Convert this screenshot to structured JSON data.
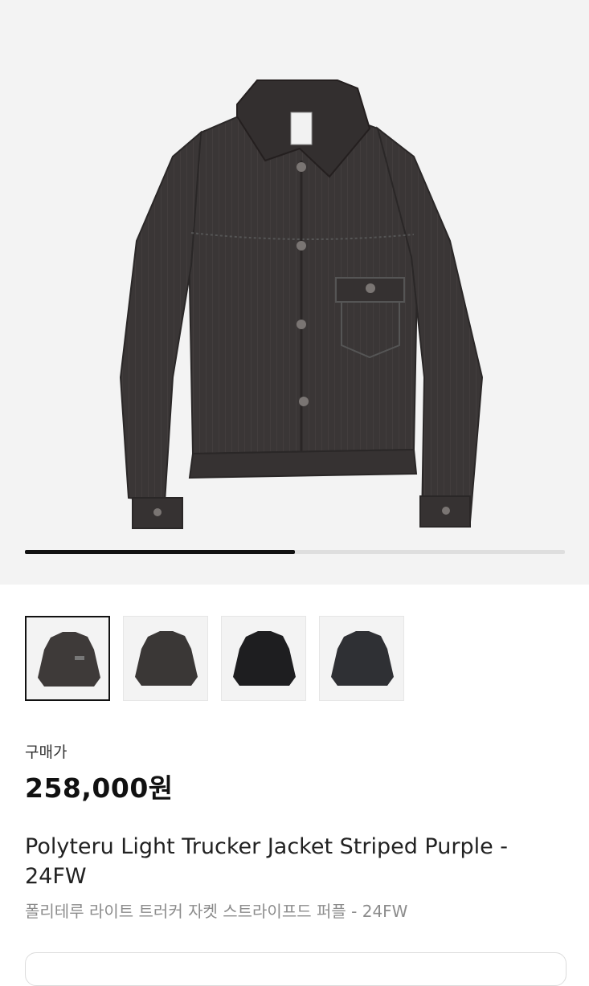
{
  "gallery": {
    "current_index": 1,
    "total": 2,
    "progress_fraction": 0.5,
    "jacket_color": "#3a3636",
    "track_color": "#dedede",
    "fill_color": "#111111"
  },
  "thumbnails": [
    {
      "name": "thumb-1",
      "jacket_color": "#3e3a39",
      "selected": true
    },
    {
      "name": "thumb-2",
      "jacket_color": "#3a3736",
      "selected": false
    },
    {
      "name": "thumb-3",
      "jacket_color": "#1e1e20",
      "selected": false
    },
    {
      "name": "thumb-4",
      "jacket_color": "#2f3034",
      "selected": false
    }
  ],
  "product": {
    "price_label": "구매가",
    "price": "258,000원",
    "title": "Polyteru Light Trucker Jacket Striped Purple - 24FW",
    "subtitle": "폴리테루 라이트 트러커 자켓 스트라이프드 퍼플 - 24FW"
  }
}
